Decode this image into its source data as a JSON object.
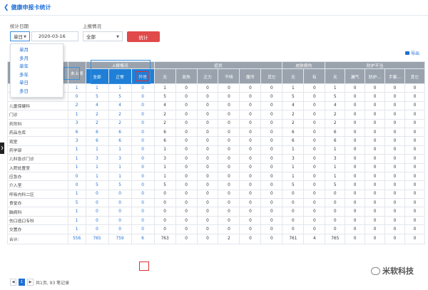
{
  "page": {
    "title": "健康申报卡统计"
  },
  "filters": {
    "date_label": "统计日期",
    "mode_value": "单日",
    "date_value": "2020-03-16",
    "report_label": "上报情况",
    "report_value": "全部",
    "stat_button": "统计"
  },
  "dropdown": [
    "单月",
    "多月",
    "单年",
    "多年",
    "单日",
    "多日"
  ],
  "export_label": "导出",
  "groups": [
    "上报情况",
    "症状",
    "皮肤损伤",
    "防护不当"
  ],
  "not_reported": "未上报",
  "cols": [
    "全部",
    "正常",
    "异常",
    "无",
    "发热",
    "乏力",
    "干咳",
    "腹泻",
    "其它",
    "无",
    "有",
    "无",
    "漏气",
    "防护...",
    "手套...",
    "其它"
  ],
  "rows": [
    {
      "name": "",
      "v": [
        "1",
        "1",
        "1",
        "0",
        "1",
        "0",
        "0",
        "0",
        "0",
        "0",
        "1",
        "0",
        "1",
        "0",
        "0",
        "0",
        "0"
      ]
    },
    {
      "name": "",
      "v": [
        "0",
        "5",
        "5",
        "0",
        "5",
        "0",
        "0",
        "0",
        "0",
        "0",
        "5",
        "0",
        "5",
        "0",
        "0",
        "0",
        "0"
      ]
    },
    {
      "name": "儿童保健科",
      "v": [
        "2",
        "4",
        "4",
        "0",
        "4",
        "0",
        "0",
        "0",
        "0",
        "0",
        "4",
        "0",
        "4",
        "0",
        "0",
        "0",
        "0"
      ]
    },
    {
      "name": "门诊",
      "v": [
        "1",
        "2",
        "2",
        "0",
        "2",
        "0",
        "0",
        "0",
        "0",
        "0",
        "2",
        "0",
        "2",
        "0",
        "0",
        "0",
        "0"
      ]
    },
    {
      "name": "药剂科",
      "v": [
        "3",
        "2",
        "2",
        "0",
        "2",
        "0",
        "0",
        "0",
        "0",
        "0",
        "2",
        "0",
        "2",
        "0",
        "0",
        "0",
        "0"
      ]
    },
    {
      "name": "药品仓库",
      "v": [
        "6",
        "6",
        "6",
        "0",
        "6",
        "0",
        "0",
        "0",
        "0",
        "0",
        "6",
        "0",
        "6",
        "0",
        "0",
        "0",
        "0"
      ]
    },
    {
      "name": "观室",
      "v": [
        "3",
        "6",
        "6",
        "0",
        "6",
        "0",
        "0",
        "0",
        "0",
        "0",
        "6",
        "0",
        "6",
        "0",
        "0",
        "0",
        "0"
      ]
    },
    {
      "name": "药学部",
      "v": [
        "1",
        "1",
        "1",
        "0",
        "1",
        "0",
        "0",
        "0",
        "0",
        "0",
        "1",
        "0",
        "1",
        "0",
        "0",
        "0",
        "0"
      ]
    },
    {
      "name": "儿科急诊门诊",
      "v": [
        "1",
        "3",
        "3",
        "0",
        "3",
        "0",
        "0",
        "0",
        "0",
        "0",
        "3",
        "0",
        "3",
        "0",
        "0",
        "0",
        "0"
      ]
    },
    {
      "name": "入院处置室",
      "v": [
        "1",
        "1",
        "1",
        "0",
        "1",
        "0",
        "0",
        "0",
        "0",
        "0",
        "1",
        "0",
        "1",
        "0",
        "0",
        "0",
        "0"
      ]
    },
    {
      "name": "应急办",
      "v": [
        "0",
        "1",
        "1",
        "0",
        "1",
        "0",
        "0",
        "0",
        "0",
        "0",
        "1",
        "0",
        "1",
        "0",
        "0",
        "0",
        "0"
      ]
    },
    {
      "name": "介入室",
      "v": [
        "0",
        "5",
        "5",
        "0",
        "5",
        "0",
        "0",
        "0",
        "0",
        "0",
        "5",
        "0",
        "5",
        "0",
        "0",
        "0",
        "0"
      ]
    },
    {
      "name": "呼吸内科二区",
      "v": [
        "1",
        "0",
        "0",
        "0",
        "0",
        "0",
        "0",
        "0",
        "0",
        "0",
        "0",
        "0",
        "0",
        "0",
        "0",
        "0",
        "0"
      ]
    },
    {
      "name": "食堂办",
      "v": [
        "5",
        "0",
        "0",
        "0",
        "0",
        "0",
        "0",
        "0",
        "0",
        "0",
        "0",
        "0",
        "0",
        "0",
        "0",
        "0",
        "0"
      ]
    },
    {
      "name": "脑病科",
      "v": [
        "1",
        "0",
        "0",
        "0",
        "0",
        "0",
        "0",
        "0",
        "0",
        "0",
        "0",
        "0",
        "0",
        "0",
        "0",
        "0",
        "0"
      ]
    },
    {
      "name": "伤口造口专科",
      "v": [
        "1",
        "0",
        "0",
        "0",
        "0",
        "0",
        "0",
        "0",
        "0",
        "0",
        "0",
        "0",
        "0",
        "0",
        "0",
        "0",
        "0"
      ]
    },
    {
      "name": "交置办",
      "v": [
        "1",
        "0",
        "0",
        "0",
        "0",
        "0",
        "0",
        "0",
        "0",
        "0",
        "0",
        "0",
        "0",
        "0",
        "0",
        "0",
        "0"
      ]
    }
  ],
  "total": {
    "name": "合计:",
    "v": [
      "556",
      "765",
      "759",
      "6",
      "763",
      "0",
      "0",
      "2",
      "0",
      "0",
      "761",
      "4",
      "765",
      "0",
      "0",
      "0",
      "0"
    ]
  },
  "pager": {
    "page": "1",
    "info": "共1页, 93 笔记录"
  },
  "watermark": "米软科技"
}
